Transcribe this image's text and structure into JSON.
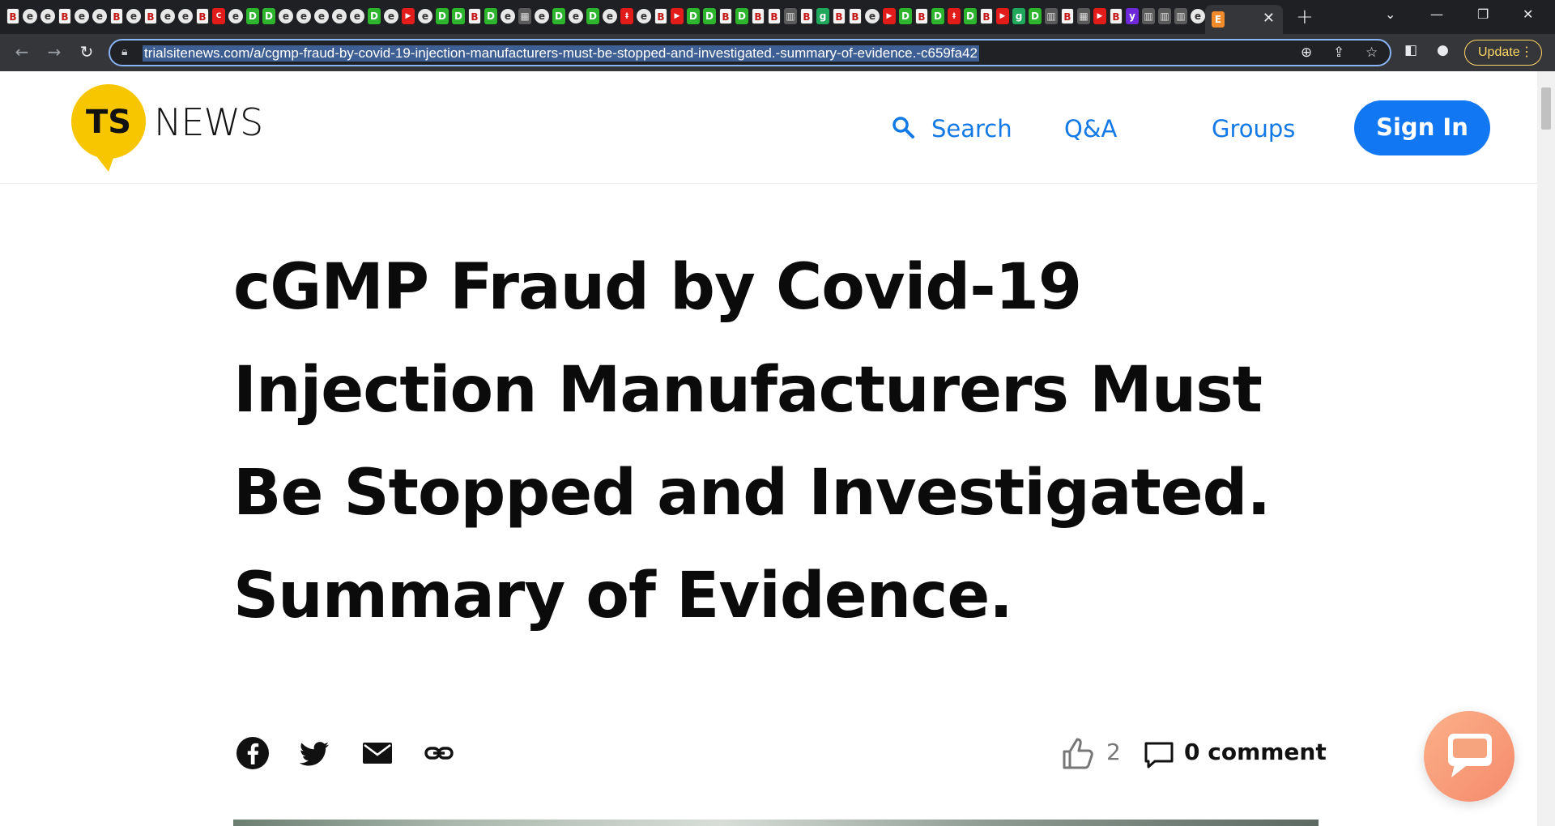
{
  "browser": {
    "tab_icons": [
      "B",
      "e",
      "e",
      "B",
      "e",
      "e",
      "B",
      "e",
      "B",
      "e",
      "e",
      "B",
      "C",
      "e",
      "D",
      "D",
      "e",
      "e",
      "e",
      "e",
      "e",
      "D",
      "e",
      "▶",
      "e",
      "D",
      "D",
      "B",
      "D",
      "e",
      "▦",
      "e",
      "D",
      "e",
      "D",
      "e",
      "‡",
      "e",
      "B",
      "▶",
      "D",
      "D",
      "B",
      "D",
      "B",
      "B",
      "▥",
      "B",
      "g",
      "B",
      "B",
      "e",
      "▶",
      "D",
      "B",
      "D",
      "‡",
      "D",
      "B",
      "▶",
      "g",
      "D",
      "▥",
      "B",
      "▦",
      "▶",
      "B",
      "y",
      "▥",
      "▥",
      "▥",
      "e",
      "▤",
      "*",
      "//",
      "▬"
    ],
    "active_tab_icon": "E",
    "new_tab_label": "+",
    "url": "trialsitenews.com/a/cgmp-fraud-by-covid-19-injection-manufacturers-must-be-stopped-and-investigated.-summary-of-evidence.-c659fa42",
    "update_label": "Update"
  },
  "site": {
    "logo_ts": "TS",
    "logo_news": "NEWS",
    "nav": {
      "search": "Search",
      "qa": "Q&A",
      "groups": "Groups",
      "signin": "Sign In"
    }
  },
  "article": {
    "title": "cGMP Fraud by Covid-19 Injection Manufacturers Must Be Stopped and Investigated. Summary of Evidence.",
    "likes_count": "2",
    "comments_label": "0 comment"
  },
  "colors": {
    "brand_yellow": "#f7c600",
    "link_blue": "#1279e6",
    "signin_blue": "#1177f2",
    "chat_orange": "#f58a6b"
  }
}
